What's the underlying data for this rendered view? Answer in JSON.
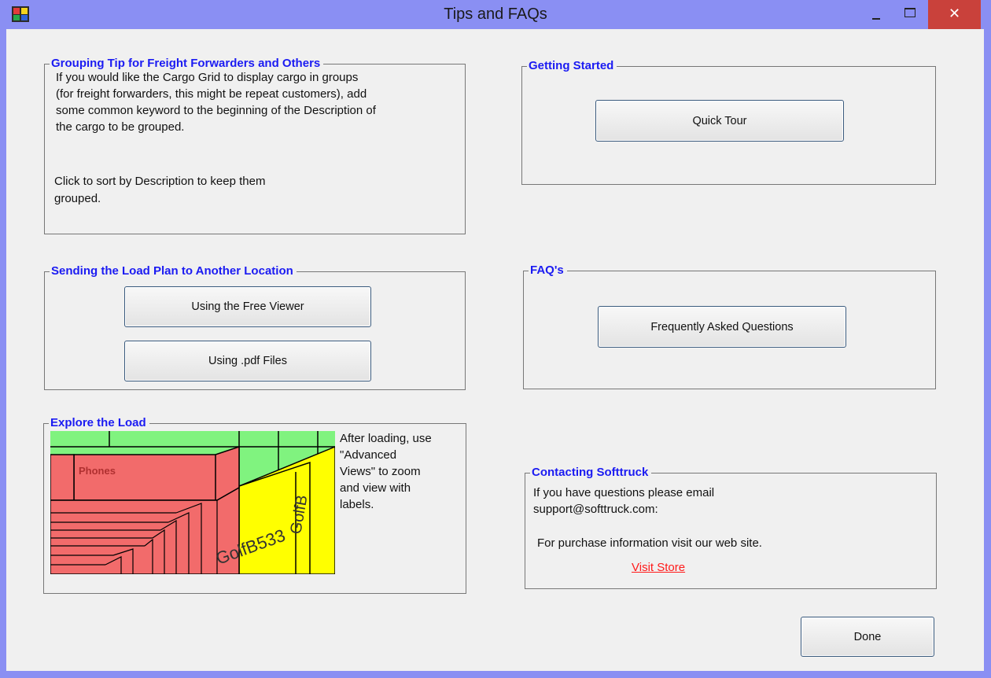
{
  "window": {
    "title": "Tips and FAQs",
    "close_glyph": "✕"
  },
  "grouping": {
    "legend": "Grouping Tip for Freight Forwarders and Others",
    "lines": [
      "If you would like the Cargo Grid to display cargo in groups",
      "(for freight forwarders, this might be repeat customers), add",
      "some common keyword to the beginning of the Description of",
      "the cargo to be grouped."
    ],
    "sort_lines": [
      "Click to sort by Description to keep them",
      "grouped."
    ]
  },
  "sending": {
    "legend": "Sending the Load Plan to Another Location",
    "free_viewer_label": "Using the Free Viewer",
    "pdf_label": "Using .pdf Files"
  },
  "explore": {
    "legend": "Explore the Load",
    "lines": [
      "After loading, use",
      "\"Advanced",
      "Views\" to zoom",
      "and view with",
      "labels."
    ],
    "image_labels": [
      "Phones",
      "GolfB533",
      "GolfB"
    ]
  },
  "getting_started": {
    "legend": "Getting Started",
    "quick_tour_label": "Quick Tour"
  },
  "faqs": {
    "legend": "FAQ's",
    "faq_label": "Frequently Asked Questions"
  },
  "contact": {
    "legend": "Contacting Softtruck",
    "lines": [
      "If you have questions please email",
      "support@softtruck.com:"
    ],
    "purchase_text": "For purchase information visit our web site.",
    "store_link": "Visit Store"
  },
  "done_label": "Done",
  "colors": {
    "title_bar": "#8a8ff3",
    "legend_text": "#1b1bf2",
    "close_button": "#c9413b",
    "link": "#ff1a1a",
    "cargo_red": "#f26b6b",
    "cargo_green": "#80f37f",
    "cargo_yellow": "#ffff00"
  }
}
